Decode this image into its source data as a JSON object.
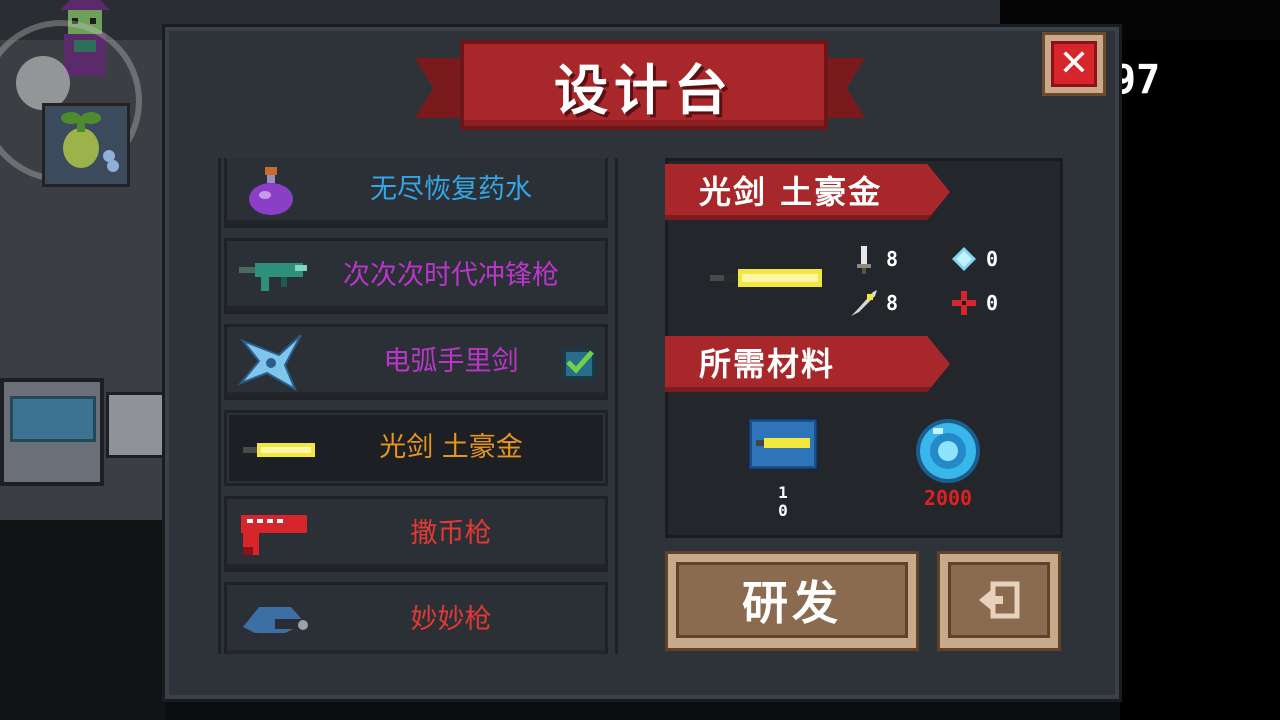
{
  "dialog": {
    "title": "设计台",
    "close_icon": "close-icon"
  },
  "hud": {
    "counter_text": "97"
  },
  "items": [
    {
      "label": "无尽恢复药水",
      "color": "#33a7e6",
      "icon": "purple-potion-icon",
      "checked": false
    },
    {
      "label": "次次次时代冲锋枪",
      "color": "#b936c9",
      "icon": "teal-smg-icon",
      "checked": false
    },
    {
      "label": "电弧手里剑",
      "color": "#b936c9",
      "icon": "shuriken-icon",
      "checked": true
    },
    {
      "label": "光剑 土豪金",
      "color": "#e8951f",
      "icon": "gold-lightsaber-icon",
      "checked": false
    },
    {
      "label": "撒币枪",
      "color": "#e23a33",
      "icon": "red-coin-gun-icon",
      "checked": false
    },
    {
      "label": "妙妙枪",
      "color": "#e23a33",
      "icon": "blue-gun-icon",
      "checked": false
    }
  ],
  "selected_index": 3,
  "detail": {
    "weapon_name": "光剑 土豪金",
    "stats": {
      "attack": "8",
      "energy": "0",
      "crit": "8",
      "precision": "0"
    },
    "materials_title": "所需材料",
    "materials": {
      "blueprint_count": "1\n0",
      "gem_cost": "2000"
    }
  },
  "buttons": {
    "develop_label": "研发",
    "exit_icon": "exit-door-icon"
  },
  "colors": {
    "panel": "#2e3339",
    "ribbon_red": "#a8272b",
    "button_tan": "#8a6b4f"
  }
}
